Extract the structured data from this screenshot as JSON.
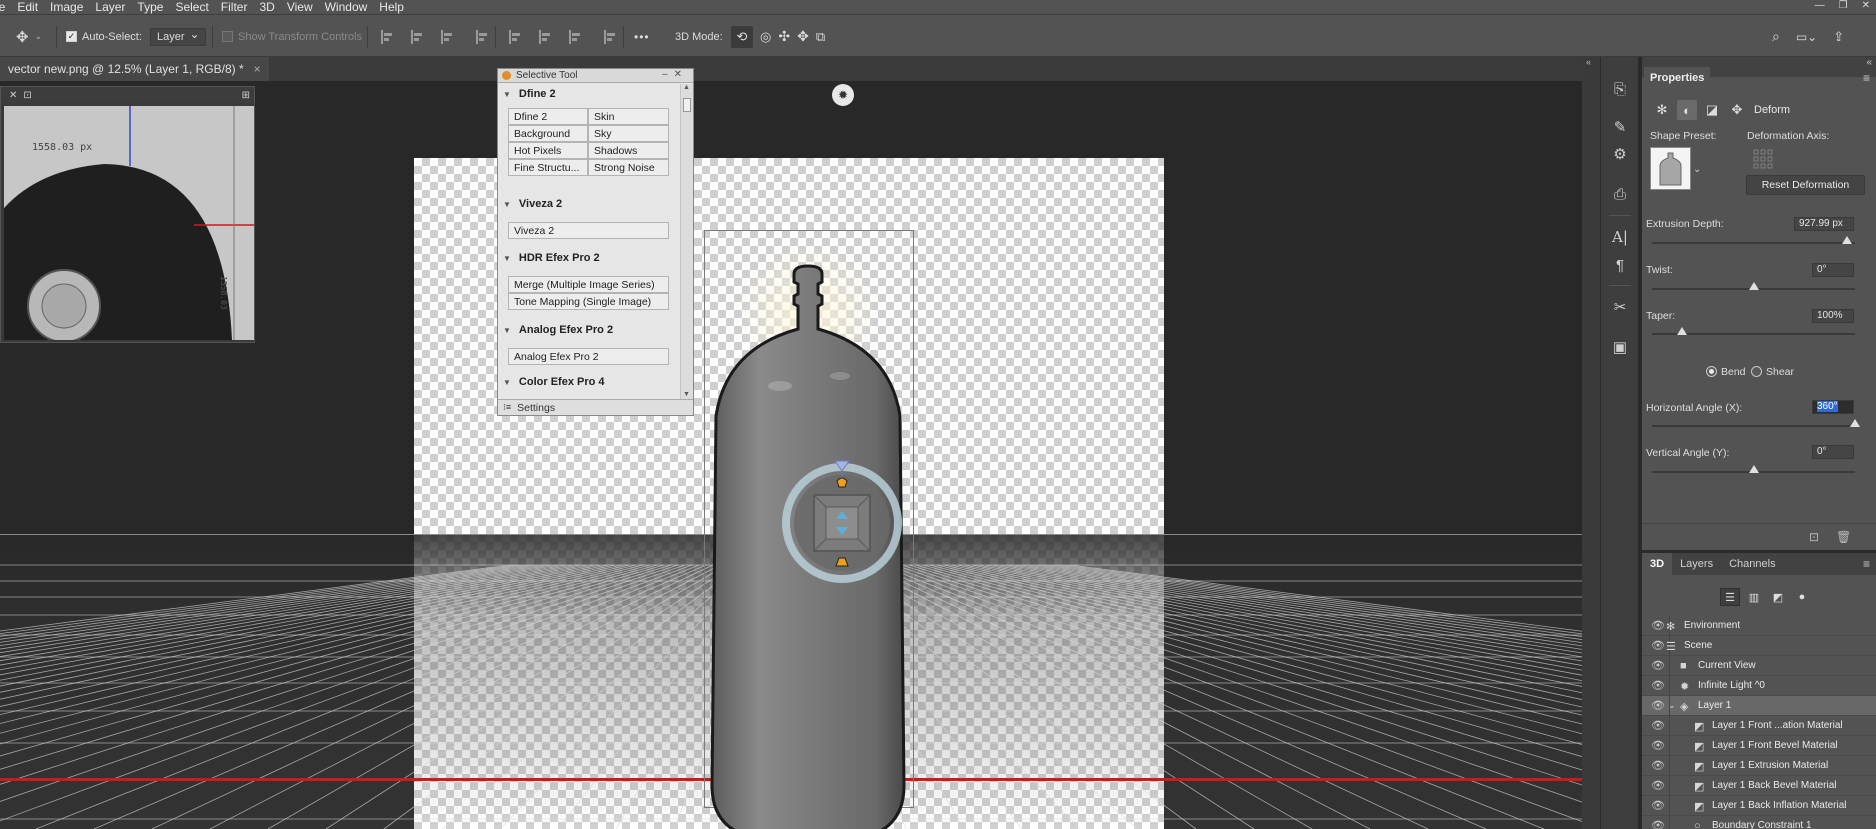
{
  "menu": [
    "le",
    "Edit",
    "Image",
    "Layer",
    "Type",
    "Select",
    "Filter",
    "3D",
    "View",
    "Window",
    "Help"
  ],
  "options_bar": {
    "auto_select_label": "Auto-Select:",
    "auto_select_value": "Layer",
    "show_transform_label": "Show Transform Controls",
    "more_glyph": "•••",
    "mode_label": "3D Mode:"
  },
  "document_tab": {
    "title": "vector new.png @ 12.5% (Layer 1, RGB/8) *",
    "close": "×"
  },
  "navigator": {
    "measure": "1558.03 px",
    "side_measure": "1558.03"
  },
  "selective_tool": {
    "title": "Selective Tool",
    "sections": [
      {
        "name": "Dfine 2",
        "buttons": [
          [
            "Dfine 2",
            "Skin"
          ],
          [
            "Background",
            "Sky"
          ],
          [
            "Hot Pixels",
            "Shadows"
          ],
          [
            "Fine Structu...",
            "Strong Noise"
          ]
        ]
      },
      {
        "name": "Viveza 2",
        "buttons": [
          [
            "Viveza 2"
          ]
        ]
      },
      {
        "name": "HDR Efex Pro 2",
        "buttons": [
          [
            "Merge (Multiple Image Series)"
          ],
          [
            "Tone Mapping (Single Image)"
          ]
        ]
      },
      {
        "name": "Analog Efex Pro 2",
        "buttons": [
          [
            "Analog Efex Pro 2"
          ]
        ]
      },
      {
        "name": "Color Efex Pro 4",
        "buttons": []
      }
    ],
    "footer": "Settings"
  },
  "properties": {
    "tab": "Properties",
    "mode_label": "Deform",
    "shape_preset_label": "Shape Preset:",
    "deformation_axis_label": "Deformation Axis:",
    "reset_button": "Reset Deformation",
    "extrusion_depth": {
      "label": "Extrusion Depth:",
      "value": "927.99 px",
      "fraction": 0.96
    },
    "twist": {
      "label": "Twist:",
      "value": "0°",
      "fraction": 0.5
    },
    "taper": {
      "label": "Taper:",
      "value": "100%",
      "fraction": 0.15
    },
    "bend_label": "Bend",
    "shear_label": "Shear",
    "bend_selected": true,
    "horizontal_angle": {
      "label": "Horizontal Angle (X):",
      "value": "360°",
      "fraction": 1.0
    },
    "vertical_angle": {
      "label": "Vertical Angle (Y):",
      "value": "0°",
      "fraction": 0.5
    }
  },
  "panel3d": {
    "tabs": [
      "3D",
      "Layers",
      "Channels"
    ],
    "items": [
      {
        "label": "Environment",
        "icon": "environment-icon",
        "selected": false
      },
      {
        "label": "Scene",
        "icon": "scene-icon",
        "selected": false
      },
      {
        "label": "Current View",
        "icon": "camera-icon",
        "selected": false
      },
      {
        "label": "Infinite Light ^0",
        "icon": "light-icon",
        "selected": false
      },
      {
        "label": "Layer 1",
        "icon": "mesh-icon",
        "selected": true
      },
      {
        "label": "Layer 1 Front ...ation Material",
        "icon": "material-icon",
        "selected": false
      },
      {
        "label": "Layer 1 Front Bevel Material",
        "icon": "material-icon",
        "selected": false
      },
      {
        "label": "Layer 1 Extrusion Material",
        "icon": "material-icon",
        "selected": false
      },
      {
        "label": "Layer 1 Back Bevel Material",
        "icon": "material-icon",
        "selected": false
      },
      {
        "label": "Layer 1 Back Inflation Material",
        "icon": "material-icon",
        "selected": false
      },
      {
        "label": "Boundary Constraint 1",
        "icon": "constraint-icon",
        "selected": false
      }
    ]
  }
}
